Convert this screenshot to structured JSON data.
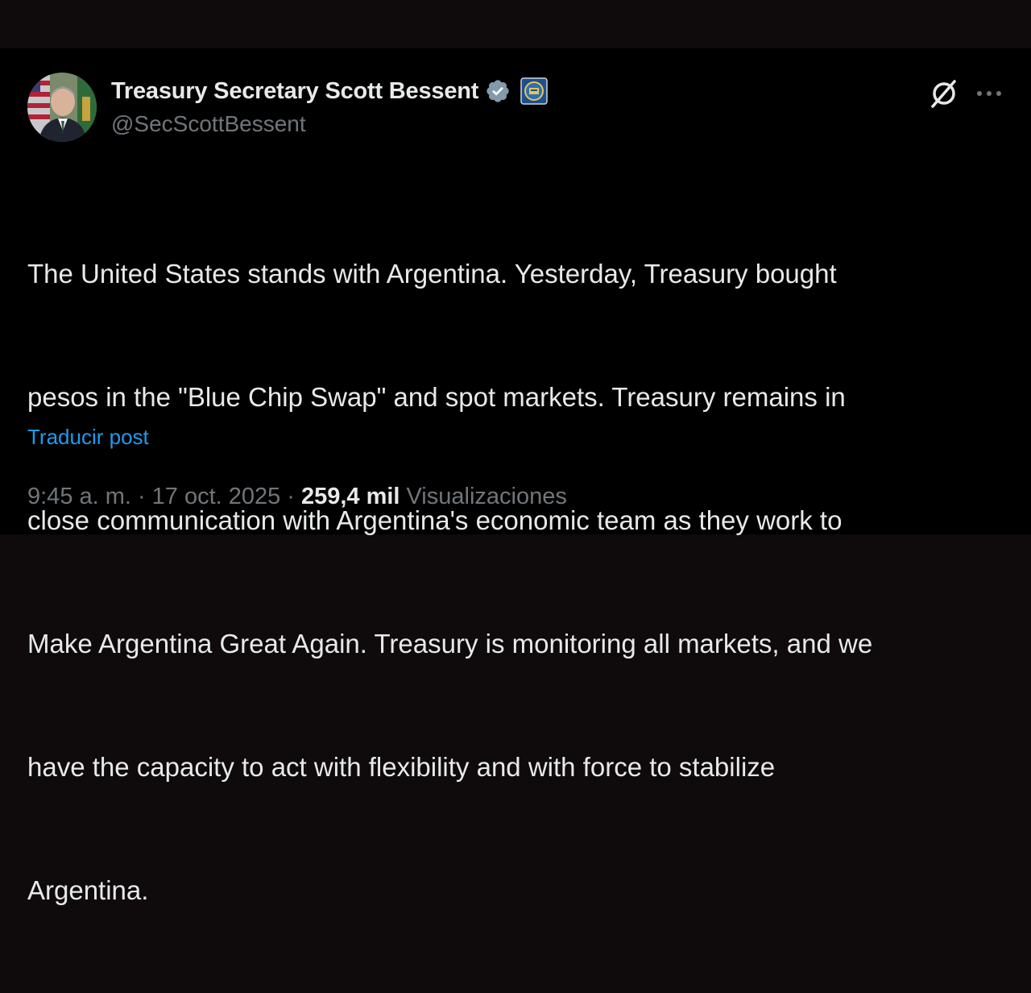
{
  "author": {
    "display_name": "Treasury Secretary Scott Bessent",
    "handle": "@SecScottBessent",
    "verified_color": "#829aab",
    "avatar_icon": "portrait-avatar",
    "affiliate_icon": "treasury-seal-icon"
  },
  "header_actions": {
    "grok_icon": "grok-icon",
    "more_icon": "more-options-icon"
  },
  "post": {
    "lines": [
      "The United States stands with Argentina. Yesterday, Treasury bought",
      "pesos in the \"Blue Chip Swap\" and spot markets. Treasury remains in",
      "close communication with Argentina's economic team as they work to",
      "Make Argentina Great Again. Treasury is monitoring all markets, and we",
      "have the capacity to act with flexibility and with force to stabilize",
      "Argentina."
    ],
    "translate_label": "Traducir post"
  },
  "meta": {
    "time": "9:45 a. m.",
    "separator": "·",
    "date": "17 oct. 2025",
    "views_count": "259,4 mil",
    "views_label": "Visualizaciones"
  },
  "colors": {
    "background": "#000000",
    "text": "#e7e9ea",
    "secondary": "#71767b",
    "link": "#1d9bf0"
  }
}
